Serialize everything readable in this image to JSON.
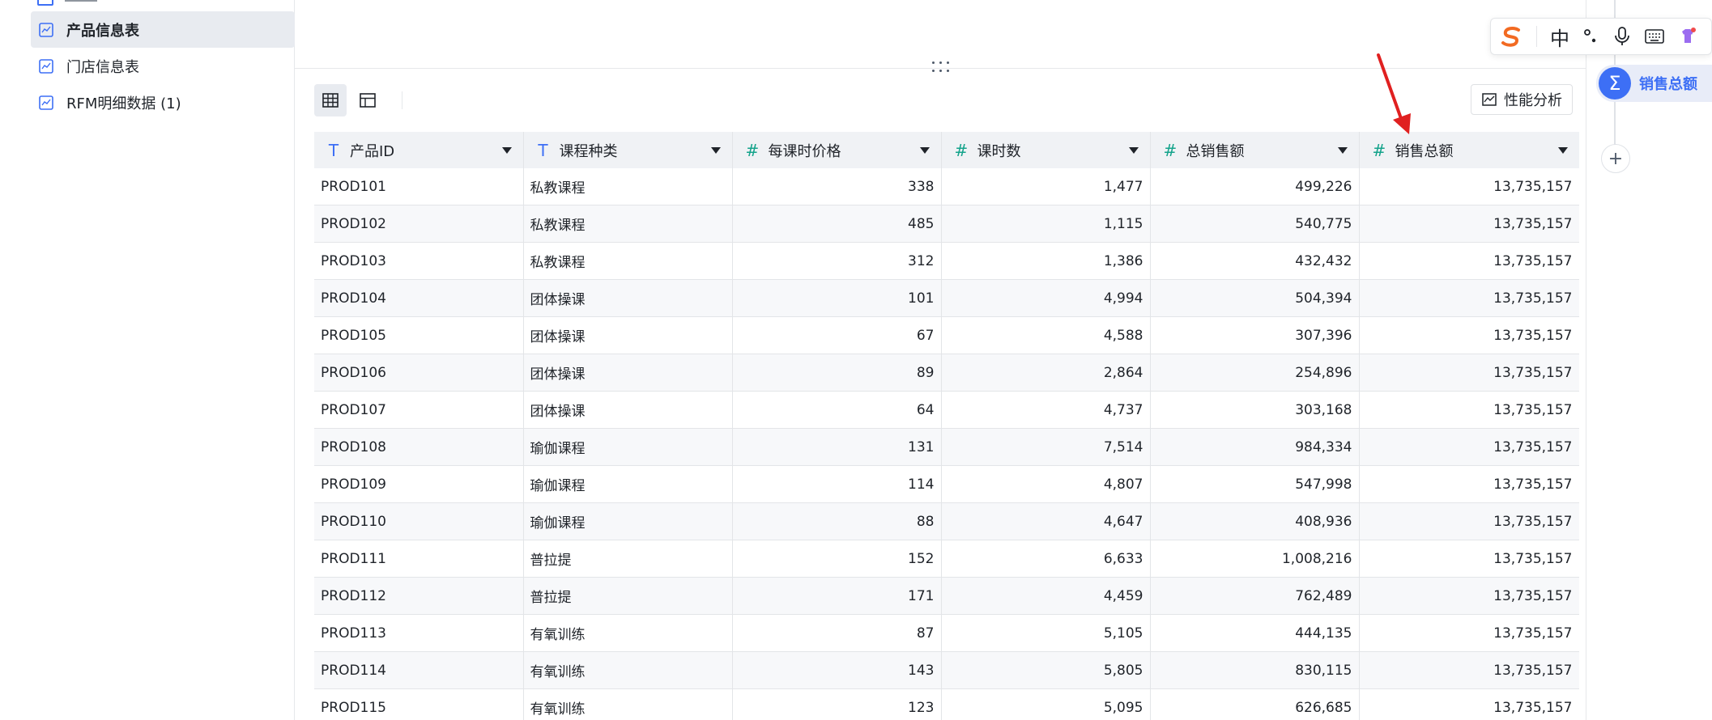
{
  "sidebar": {
    "items": [
      {
        "label": "产品信息表",
        "active": true
      },
      {
        "label": "门店信息表",
        "active": false
      },
      {
        "label": "RFM明细数据 (1)",
        "active": false
      }
    ]
  },
  "toolbar": {
    "grid_view_icon": "grid-view-icon",
    "layout_view_icon": "layout-view-icon",
    "perf_label": "性能分析"
  },
  "table": {
    "columns": [
      {
        "type": "text",
        "label": "产品ID"
      },
      {
        "type": "text",
        "label": "课程种类"
      },
      {
        "type": "number",
        "label": "每课时价格"
      },
      {
        "type": "number",
        "label": "课时数"
      },
      {
        "type": "number",
        "label": "总销售额"
      },
      {
        "type": "number",
        "label": "销售总额"
      }
    ],
    "rows": [
      [
        "PROD101",
        "私教课程",
        "338",
        "1,477",
        "499,226",
        "13,735,157"
      ],
      [
        "PROD102",
        "私教课程",
        "485",
        "1,115",
        "540,775",
        "13,735,157"
      ],
      [
        "PROD103",
        "私教课程",
        "312",
        "1,386",
        "432,432",
        "13,735,157"
      ],
      [
        "PROD104",
        "团体操课",
        "101",
        "4,994",
        "504,394",
        "13,735,157"
      ],
      [
        "PROD105",
        "团体操课",
        "67",
        "4,588",
        "307,396",
        "13,735,157"
      ],
      [
        "PROD106",
        "团体操课",
        "89",
        "2,864",
        "254,896",
        "13,735,157"
      ],
      [
        "PROD107",
        "团体操课",
        "64",
        "4,737",
        "303,168",
        "13,735,157"
      ],
      [
        "PROD108",
        "瑜伽课程",
        "131",
        "7,514",
        "984,334",
        "13,735,157"
      ],
      [
        "PROD109",
        "瑜伽课程",
        "114",
        "4,807",
        "547,998",
        "13,735,157"
      ],
      [
        "PROD110",
        "瑜伽课程",
        "88",
        "4,647",
        "408,936",
        "13,735,157"
      ],
      [
        "PROD111",
        "普拉提",
        "152",
        "6,633",
        "1,008,216",
        "13,735,157"
      ],
      [
        "PROD112",
        "普拉提",
        "171",
        "4,459",
        "762,489",
        "13,735,157"
      ],
      [
        "PROD113",
        "有氧训练",
        "87",
        "5,105",
        "444,135",
        "13,735,157"
      ],
      [
        "PROD114",
        "有氧训练",
        "143",
        "5,805",
        "830,115",
        "13,735,157"
      ],
      [
        "PROD115",
        "有氧训练",
        "123",
        "5,095",
        "626,685",
        "13,735,157"
      ]
    ]
  },
  "right_panel": {
    "active_label": "销售总额",
    "add_label": "+"
  },
  "ime": {
    "mode_label": "中"
  },
  "colors": {
    "accent": "#3d6ff5",
    "number_icon": "#14a38b",
    "arrow": "#e02020"
  }
}
